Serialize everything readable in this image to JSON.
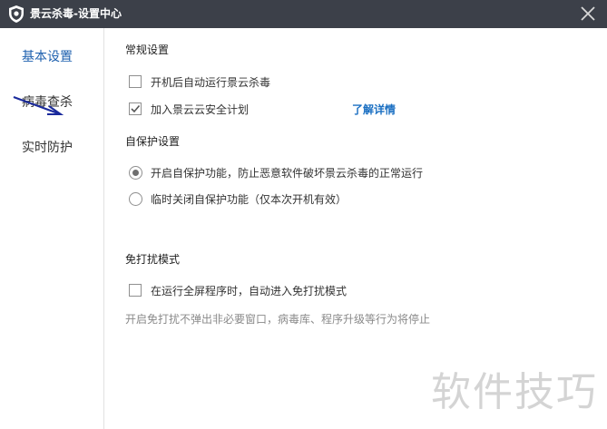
{
  "window": {
    "title": "景云杀毒-设置中心",
    "icon": "shield-logo-icon",
    "close_icon": "close-icon"
  },
  "sidebar": {
    "items": [
      {
        "label": "基本设置",
        "active": true
      },
      {
        "label": "病毒查杀",
        "active": false
      },
      {
        "label": "实时防护",
        "active": false
      }
    ],
    "annotation_icon": "arrow-annotation-icon"
  },
  "sections": {
    "general": {
      "title": "常规设置",
      "options": [
        {
          "label": "开机后自动运行景云杀毒",
          "checked": false
        },
        {
          "label": "加入景云云安全计划",
          "checked": true
        }
      ],
      "link": "了解详情"
    },
    "self_protect": {
      "title": "自保护设置",
      "options": [
        {
          "label": "开启自保护功能，防止恶意软件破坏景云杀毒的正常运行",
          "selected": true
        },
        {
          "label": "临时关闭自保护功能（仅本次开机有效）",
          "selected": false
        }
      ]
    },
    "do_not_disturb": {
      "title": "免打扰模式",
      "option": {
        "label": "在运行全屏程序时，自动进入免打扰模式",
        "checked": false
      },
      "hint": "开启免打扰不弹出非必要窗口，病毒库、程序升级等行为将停止"
    }
  },
  "watermark": "软件技巧",
  "colors": {
    "titlebar": "#3c4049",
    "active_nav": "#1c5fae",
    "link": "#1a6fc2",
    "arrow": "#1a2a9c"
  }
}
